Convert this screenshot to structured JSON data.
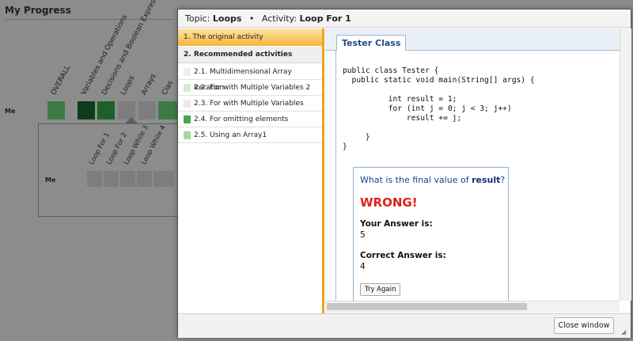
{
  "background": {
    "title": "My Progress",
    "row_label": "Me",
    "topic_labels": [
      "OVERALL",
      "Variables and Operations",
      "Decisions and Boolean Express",
      "Loops",
      "Arrays",
      "Clas"
    ],
    "sub_row_label": "Me",
    "sub_labels": [
      "Loop For 1",
      "Loop For 2",
      "Loop While 3",
      "Loop While 4"
    ]
  },
  "modal": {
    "header": {
      "topic_prefix": "Topic:",
      "topic": "Loops",
      "separator": "•",
      "activity_prefix": "Activity:",
      "activity": "Loop For 1"
    },
    "original_activity": "1. The original activity",
    "recommended_heading": "2. Recommended activities",
    "recommended": [
      {
        "label": "2.1. Multidimensional Array Iteration",
        "color": "#eeeeee"
      },
      {
        "label": "2.2. For with Multiple Variables 2",
        "color": "#d5ebd2"
      },
      {
        "label": "2.3. For with Multiple Variables",
        "color": "#e9e9e9"
      },
      {
        "label": "2.4. For omitting elements",
        "color": "#4aa34e"
      },
      {
        "label": "2.5. Using an Array1",
        "color": "#a9d6a2"
      }
    ],
    "tab_label": "Tester Class",
    "code": "public class Tester {\n  public static void main(String[] args) {\n\n          int result = 1;\n          for (int j = 0; j < 3; j++)\n              result += j;\n\n     }\n}",
    "question": {
      "prefix": "What is the final value of ",
      "variable": "result",
      "suffix": "?",
      "verdict": "WRONG!",
      "your_answer_label": "Your Answer is:",
      "your_answer": "5",
      "correct_answer_label": "Correct Answer is:",
      "correct_answer": "4",
      "try_again": "Try Again"
    },
    "close_button": "Close window"
  },
  "colors": {
    "accent_orange": "#f0a020",
    "wrong_red": "#e0201b",
    "tab_blue": "#234d82"
  }
}
